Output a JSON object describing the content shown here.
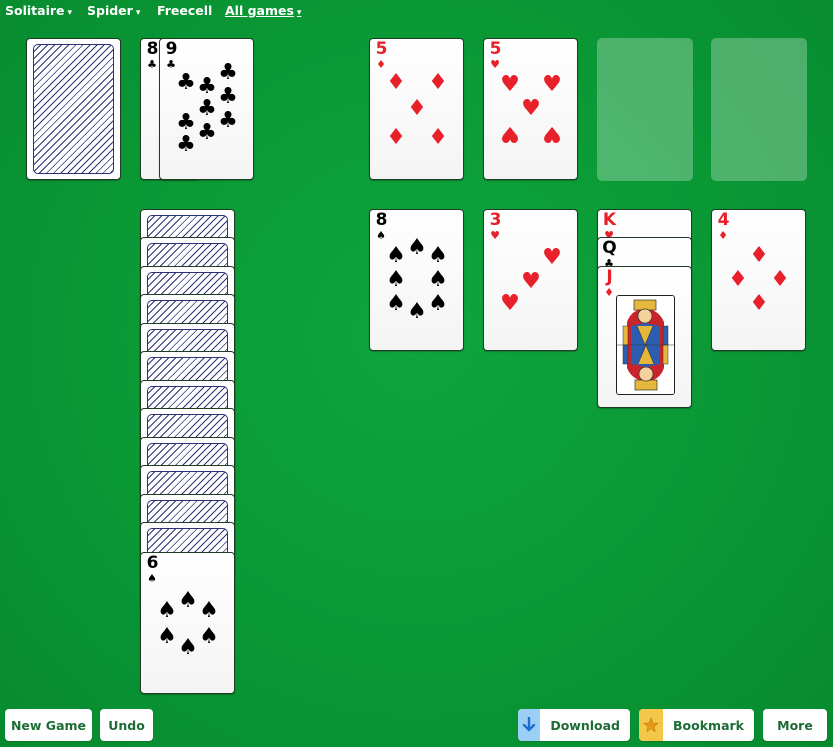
{
  "nav": {
    "items": [
      {
        "label": "Solitaire",
        "dropdown": true
      },
      {
        "label": "Spider",
        "dropdown": true
      },
      {
        "label": "Freecell",
        "dropdown": false
      },
      {
        "label": "All games",
        "dropdown": true
      }
    ]
  },
  "stock": {
    "face_down_count": 1
  },
  "waste": [
    {
      "rank": "8",
      "suit": "clubs",
      "suit_symbol": "♣",
      "color": "black"
    },
    {
      "rank": "9",
      "suit": "clubs",
      "suit_symbol": "♣",
      "color": "black"
    }
  ],
  "foundations": [
    {
      "rank": "5",
      "suit": "diamonds",
      "suit_symbol": "♦",
      "color": "red"
    },
    {
      "rank": "5",
      "suit": "hearts",
      "suit_symbol": "♥",
      "color": "red"
    },
    null,
    null
  ],
  "tableau": [
    {
      "face_down_count": 12,
      "face_up": [
        {
          "rank": "6",
          "suit": "spades",
          "suit_symbol": "♠",
          "color": "black"
        }
      ]
    },
    {
      "face_down_count": 0,
      "face_up": [
        {
          "rank": "8",
          "suit": "spades",
          "suit_symbol": "♠",
          "color": "black"
        }
      ]
    },
    {
      "face_down_count": 0,
      "face_up": [
        {
          "rank": "3",
          "suit": "hearts",
          "suit_symbol": "♥",
          "color": "red"
        }
      ]
    },
    {
      "face_down_count": 0,
      "face_up": [
        {
          "rank": "K",
          "suit": "hearts",
          "suit_symbol": "♥",
          "color": "red"
        },
        {
          "rank": "Q",
          "suit": "clubs",
          "suit_symbol": "♣",
          "color": "black"
        },
        {
          "rank": "J",
          "suit": "diamonds",
          "suit_symbol": "♦",
          "color": "red"
        }
      ]
    },
    {
      "face_down_count": 0,
      "face_up": [
        {
          "rank": "4",
          "suit": "diamonds",
          "suit_symbol": "♦",
          "color": "red"
        }
      ]
    }
  ],
  "buttons": {
    "new_game": "New Game",
    "undo": "Undo",
    "download": "Download",
    "bookmark": "Bookmark",
    "more": "More"
  },
  "icons": {
    "download": "download-arrow-icon",
    "bookmark": "star-icon",
    "caret": "▾"
  },
  "colors": {
    "table_green": "#0a9835",
    "button_text": "#1d6b35",
    "card_red": "#e8202a",
    "card_back_blue": "#2d3277",
    "download_icon_bg": "#9ccff5",
    "bookmark_icon_bg": "#f2c74a"
  }
}
